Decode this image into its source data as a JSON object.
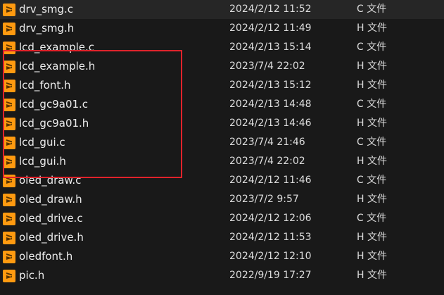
{
  "files": [
    {
      "name": "drv_smg.c",
      "date": "2024/2/12 11:52",
      "type": "C 文件",
      "icon": "sublime-text-icon"
    },
    {
      "name": "drv_smg.h",
      "date": "2024/2/12 11:49",
      "type": "H 文件",
      "icon": "sublime-text-icon"
    },
    {
      "name": "lcd_example.c",
      "date": "2024/2/13 15:14",
      "type": "C 文件",
      "icon": "sublime-text-icon"
    },
    {
      "name": "lcd_example.h",
      "date": "2023/7/4 22:02",
      "type": "H 文件",
      "icon": "sublime-text-icon"
    },
    {
      "name": "lcd_font.h",
      "date": "2024/2/13 15:12",
      "type": "H 文件",
      "icon": "sublime-text-icon"
    },
    {
      "name": "lcd_gc9a01.c",
      "date": "2024/2/13 14:48",
      "type": "C 文件",
      "icon": "sublime-text-icon"
    },
    {
      "name": "lcd_gc9a01.h",
      "date": "2024/2/13 14:46",
      "type": "H 文件",
      "icon": "sublime-text-icon"
    },
    {
      "name": "lcd_gui.c",
      "date": "2023/7/4 21:46",
      "type": "C 文件",
      "icon": "sublime-text-icon"
    },
    {
      "name": "lcd_gui.h",
      "date": "2023/7/4 22:02",
      "type": "H 文件",
      "icon": "sublime-text-icon"
    },
    {
      "name": "oled_draw.c",
      "date": "2024/2/12 11:46",
      "type": "C 文件",
      "icon": "sublime-text-icon"
    },
    {
      "name": "oled_draw.h",
      "date": "2023/7/2 9:57",
      "type": "H 文件",
      "icon": "sublime-text-icon"
    },
    {
      "name": "oled_drive.c",
      "date": "2024/2/12 12:06",
      "type": "C 文件",
      "icon": "sublime-text-icon"
    },
    {
      "name": "oled_drive.h",
      "date": "2024/2/12 11:53",
      "type": "H 文件",
      "icon": "sublime-text-icon"
    },
    {
      "name": "oledfont.h",
      "date": "2024/2/12 12:10",
      "type": "H 文件",
      "icon": "sublime-text-icon"
    },
    {
      "name": "pic.h",
      "date": "2022/9/19 17:27",
      "type": "H 文件",
      "icon": "sublime-text-icon"
    }
  ],
  "colors": {
    "background": "#191919",
    "icon_orange": "#ff9a10",
    "highlight_red": "#e0232b"
  }
}
